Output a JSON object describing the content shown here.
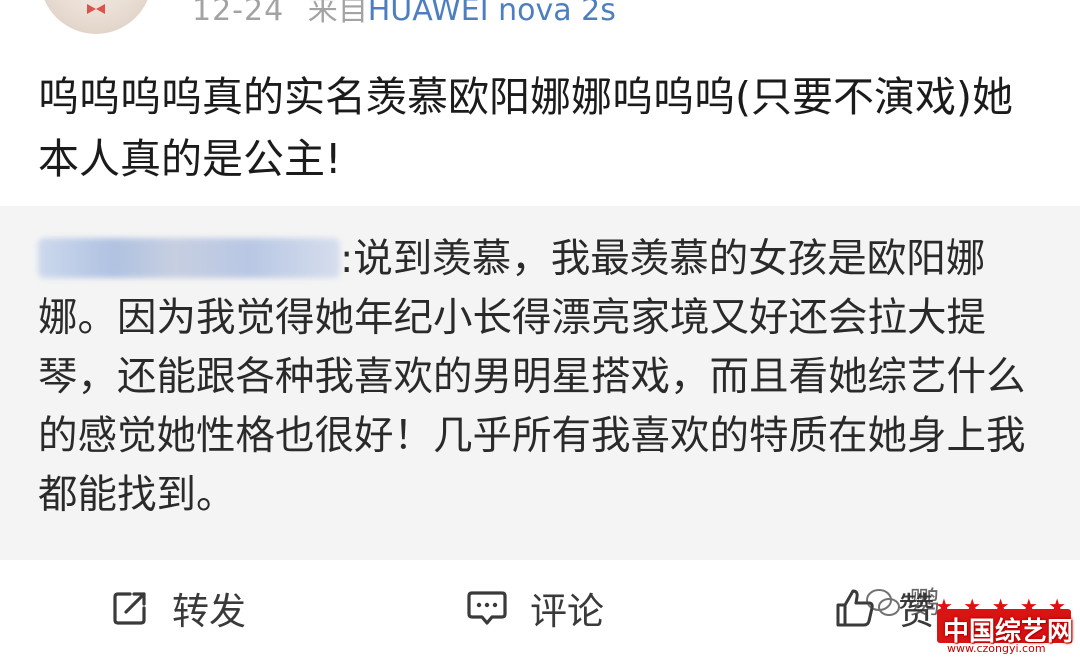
{
  "post": {
    "time": "12-24",
    "source_prefix": "来自",
    "device": "HUAWEI nova 2s",
    "text": "呜呜呜呜真的实名羡慕欧阳娜娜呜呜呜(只要不演戏)她本人真的是公主!"
  },
  "quoted": {
    "text": ":说到羡慕，我最羡慕的女孩是欧阳娜娜。因为我觉得她年纪小长得漂亮家境又好还会拉大提琴，还能跟各种我喜欢的男明星搭戏，而且看她综艺什么的感觉她性格也很好！几乎所有我喜欢的特质在她身上我都能找到。"
  },
  "actions": {
    "repost_label": "转发",
    "comment_label": "评论",
    "like_label": "赞"
  },
  "watermark": {
    "wechat_partial": "鹦",
    "site_name": "中国综艺网",
    "site_url": "www.czongyi.com"
  },
  "icons": {
    "repost": "share-external-icon",
    "comment": "comment-bubble-icon",
    "like": "thumbs-up-icon"
  },
  "colors": {
    "device_link": "#4d7fc0",
    "quote_background": "#f4f4f4",
    "watermark_red": "#d81414"
  }
}
